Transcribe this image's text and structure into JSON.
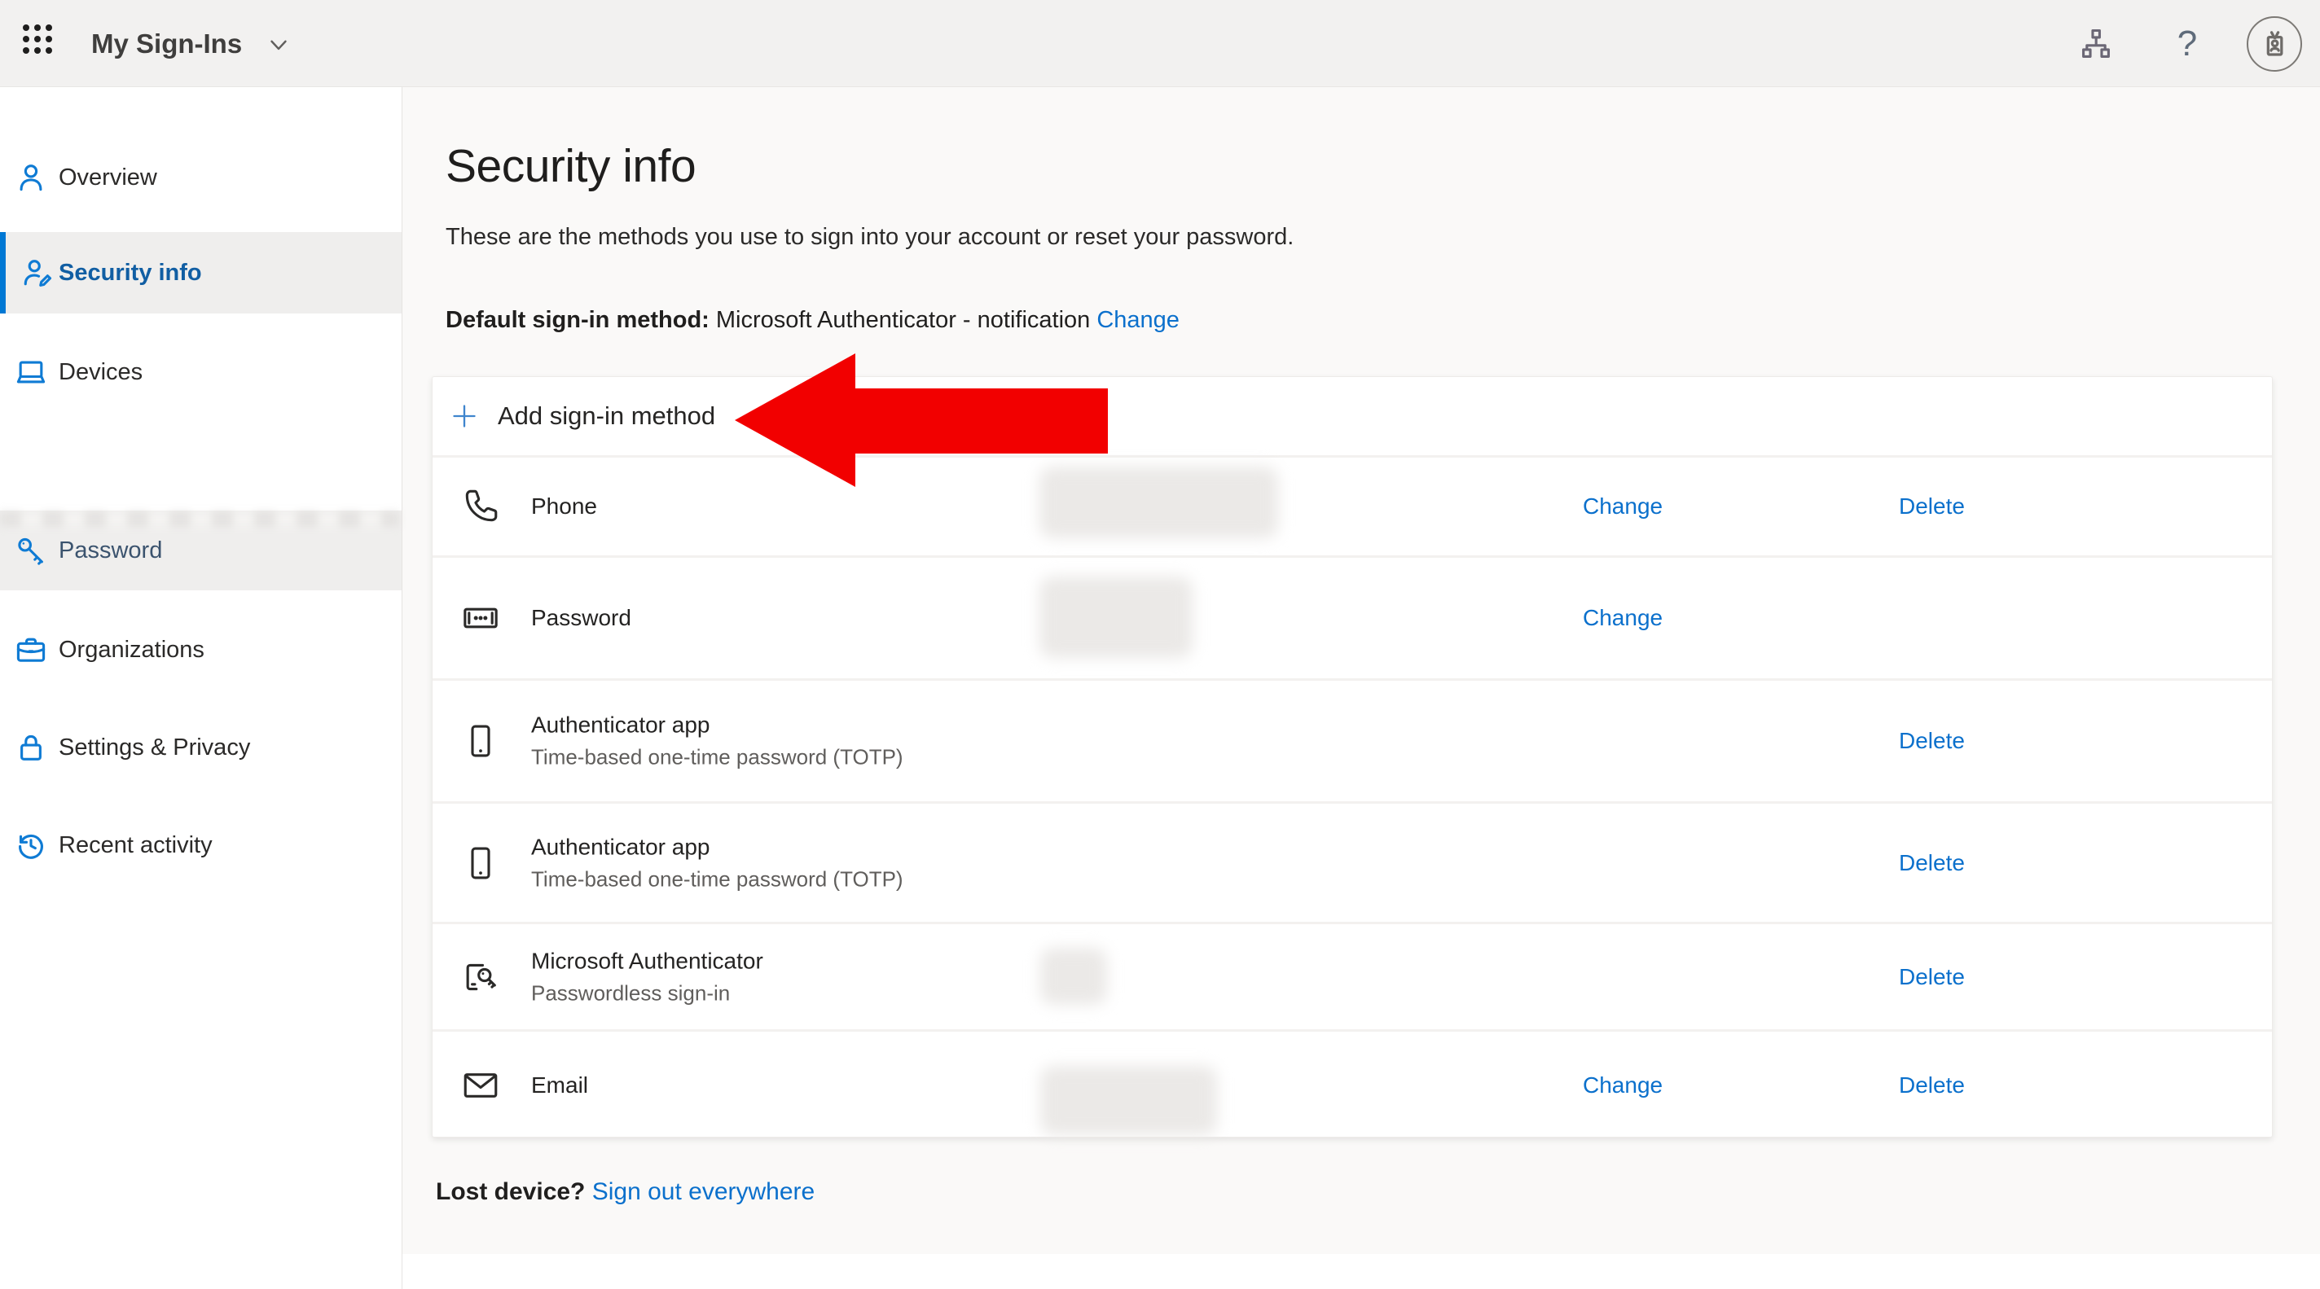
{
  "topbar": {
    "title": "My Sign-Ins",
    "help_glyph": "?",
    "icons": {
      "app_launcher": "grid-dots-waffle",
      "title_menu": "chevron-down",
      "directory": "org-chart",
      "help": "question-mark",
      "account": "id-badge-in-circle"
    }
  },
  "sidebar": {
    "items": [
      {
        "label": "Overview",
        "icon": "person",
        "state": "default"
      },
      {
        "label": "Security info",
        "icon": "person-edit",
        "state": "selected"
      },
      {
        "label": "Devices",
        "icon": "laptop",
        "state": "default"
      },
      {
        "label": "Password",
        "icon": "key",
        "state": "hover"
      },
      {
        "label": "Organizations",
        "icon": "briefcase",
        "state": "default"
      },
      {
        "label": "Settings & Privacy",
        "icon": "lock",
        "state": "default"
      },
      {
        "label": "Recent activity",
        "icon": "history-clock",
        "state": "default"
      }
    ]
  },
  "main": {
    "title": "Security info",
    "description": "These are the methods you use to sign into your account or reset your password.",
    "default_method": {
      "label": "Default sign-in method:",
      "value": "Microsoft Authenticator - notification",
      "change_label": "Change"
    },
    "add_button": {
      "label": "Add sign-in method",
      "icon": "plus"
    },
    "actions": {
      "change_label": "Change",
      "delete_label": "Delete"
    },
    "methods": [
      {
        "name": "Phone",
        "subtitle": "",
        "icon": "phone-handset",
        "value_redacted": true,
        "can_change": true,
        "can_delete": true
      },
      {
        "name": "Password",
        "subtitle": "",
        "icon": "password-field",
        "value_redacted": true,
        "can_change": true,
        "can_delete": false
      },
      {
        "name": "Authenticator app",
        "subtitle": "Time-based one-time password (TOTP)",
        "icon": "mobile-phone",
        "value_redacted": false,
        "can_change": false,
        "can_delete": true
      },
      {
        "name": "Authenticator app",
        "subtitle": "Time-based one-time password (TOTP)",
        "icon": "mobile-phone",
        "value_redacted": false,
        "can_change": false,
        "can_delete": true
      },
      {
        "name": "Microsoft Authenticator",
        "subtitle": "Passwordless sign-in",
        "icon": "device-with-key",
        "value_redacted": true,
        "can_change": false,
        "can_delete": true
      },
      {
        "name": "Email",
        "subtitle": "",
        "icon": "envelope",
        "value_redacted": true,
        "can_change": true,
        "can_delete": true
      }
    ],
    "lost_device": {
      "label": "Lost device?",
      "link_label": "Sign out everywhere"
    }
  },
  "annotation": {
    "type": "arrow-left",
    "color": "#f20000",
    "points_to": "Add sign-in method"
  },
  "colors": {
    "accent_blue": "#0078d4",
    "link_blue": "#0b70cc",
    "selected_nav_text": "#115ea3",
    "hover_nav_text": "#3b536e",
    "topbar_bg": "#f2f1f0",
    "content_bg": "#faf9f8",
    "card_bg": "#ffffff",
    "arrow_red": "#f20000"
  }
}
